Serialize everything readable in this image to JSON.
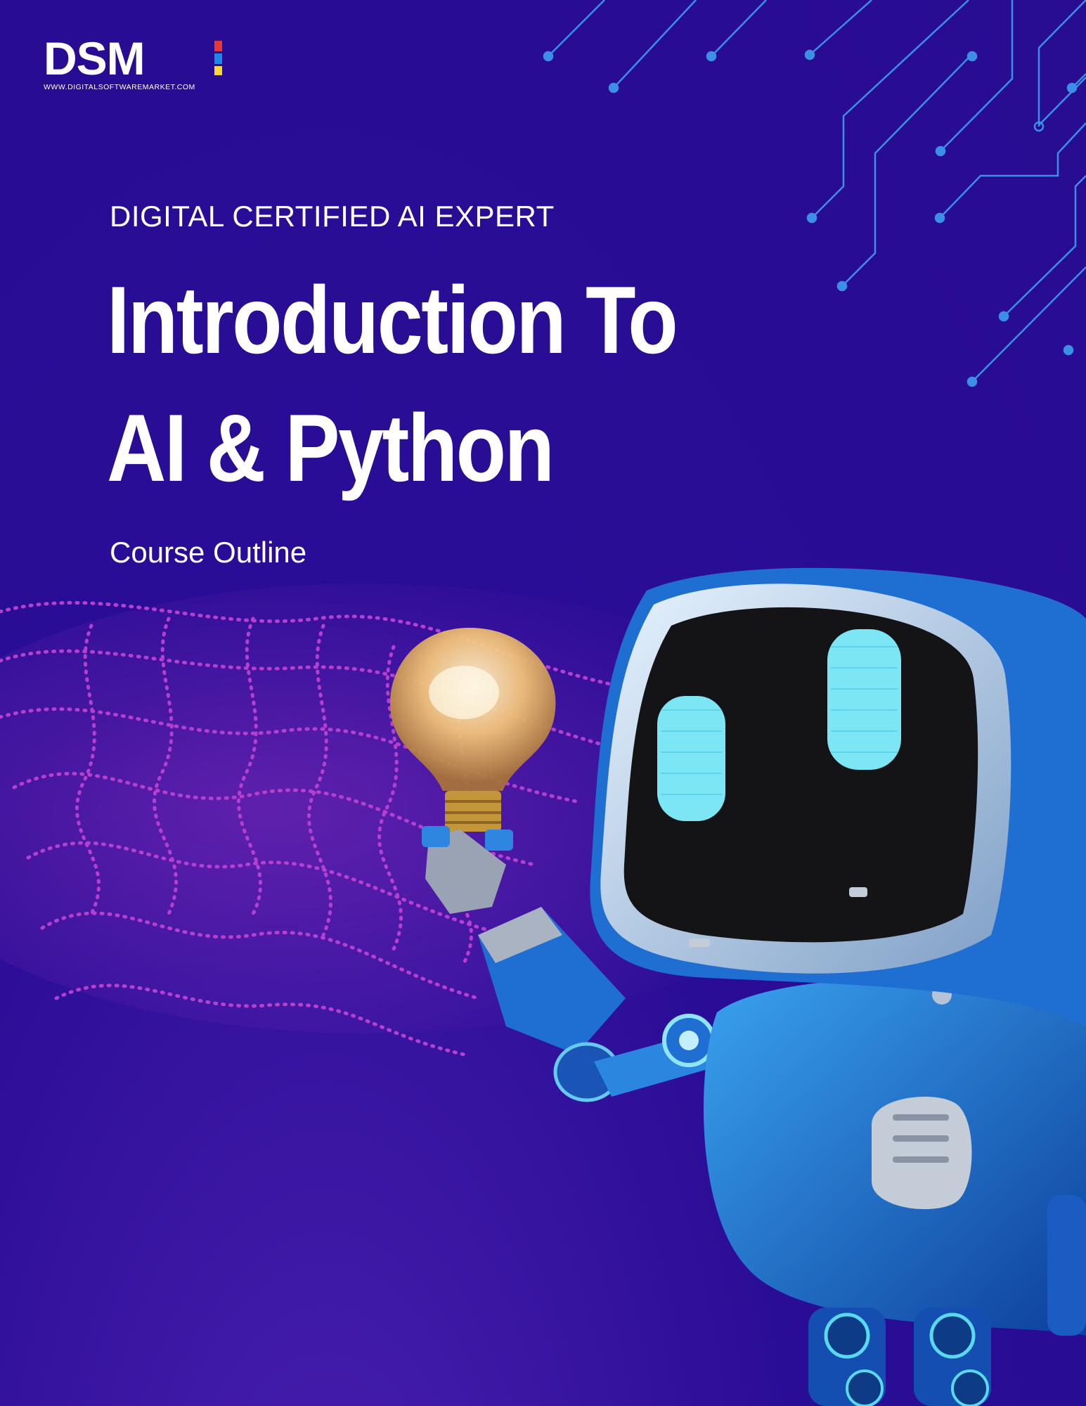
{
  "brand": {
    "logo_text": "DSM",
    "url": "WWW.DIGITALSOFTWAREMARKET.COM",
    "accent_colors": [
      "#e53935",
      "#1e88e5",
      "#fdd835"
    ]
  },
  "cover": {
    "eyebrow": "DIGITAL CERTIFIED AI EXPERT",
    "title_line1": "Introduction To",
    "title_line2": "AI & Python",
    "subtitle": "Course Outline"
  },
  "colors": {
    "background": "#2a0d96",
    "circuit": "#3d8fe6",
    "wave": "#d048d8",
    "robot_body": "#1a6fd0",
    "robot_visor": "#141417",
    "robot_eyes": "#7ce6f5",
    "bulb": "#f2c27a"
  },
  "illustration": {
    "icons": [
      "circuit-lines-icon",
      "particle-wave-icon",
      "robot-icon",
      "lightbulb-icon"
    ]
  }
}
